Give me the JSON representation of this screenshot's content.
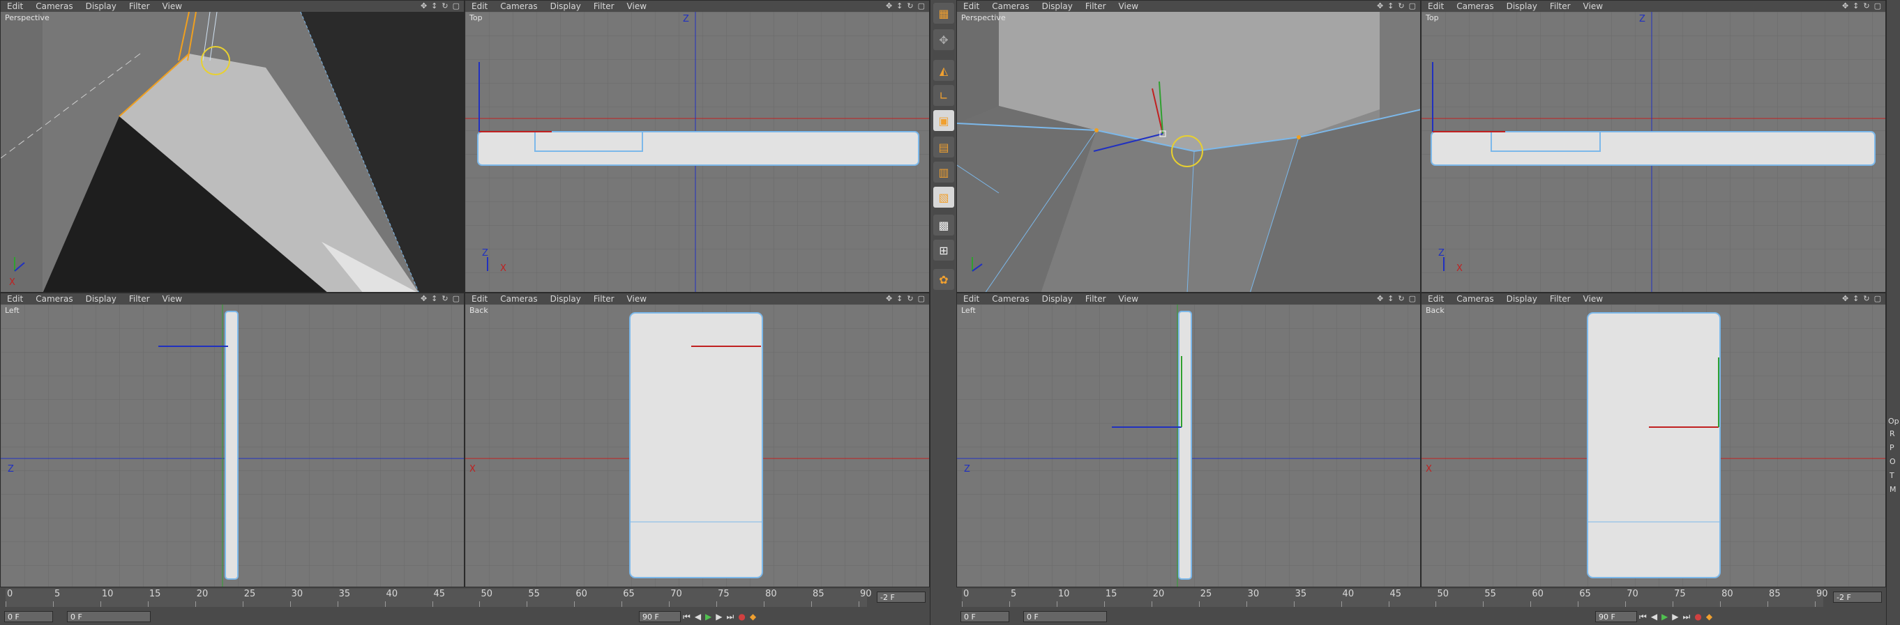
{
  "menu": [
    "Edit",
    "Cameras",
    "Display",
    "Filter",
    "View"
  ],
  "viewport_labels": {
    "persp": "Perspective",
    "top": "Top",
    "left": "Left",
    "back": "Back"
  },
  "axis": {
    "z": "Z",
    "x": "X"
  },
  "ruler_ticks": [
    "0",
    "5",
    "10",
    "15",
    "20",
    "25",
    "30",
    "35",
    "40",
    "45",
    "50",
    "55",
    "60",
    "65",
    "70",
    "75",
    "80",
    "85",
    "90"
  ],
  "timeline": {
    "current": "0 F",
    "start": "0 F",
    "end": "90 F",
    "end_right": "90 F",
    "cur_right": "-2 F"
  },
  "icons": [
    "move-view-icon",
    "zoom-view-icon",
    "rotate-view-icon",
    "maximize-view-icon"
  ],
  "right_panel": [
    "Op",
    "R",
    "P",
    "O",
    "T",
    "M"
  ],
  "colors": {
    "viewport": "#777777",
    "grid": "#6c6c6c",
    "x_axis": "#c02020",
    "z_axis": "#2030c0",
    "selection": "#7cb8ea"
  }
}
